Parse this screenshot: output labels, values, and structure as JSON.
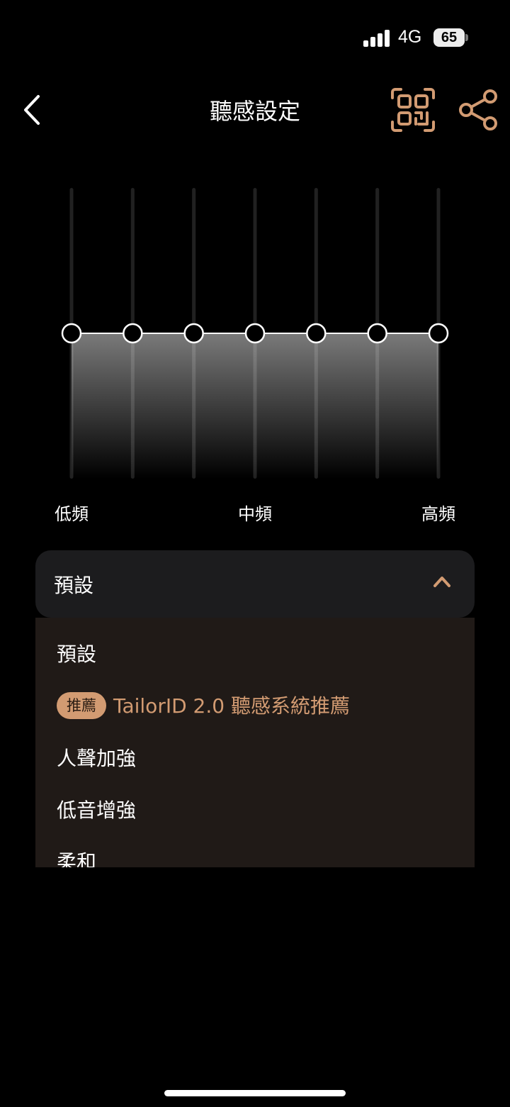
{
  "status_bar": {
    "network": "4G",
    "battery": "65"
  },
  "header": {
    "title": "聽感設定",
    "back_icon": "chevron-left-icon",
    "qr_icon": "qr-code-icon",
    "share_icon": "share-icon"
  },
  "equalizer": {
    "band_count": 7,
    "levels": [
      0,
      0,
      0,
      0,
      0,
      0,
      0
    ],
    "labels": {
      "low": "低頻",
      "mid": "中頻",
      "high": "高頻"
    }
  },
  "preset": {
    "selected": "預設",
    "expanded": true,
    "options": [
      {
        "label": "預設"
      },
      {
        "label": "TailorID 2.0 聽感系統推薦",
        "badge": "推薦"
      },
      {
        "label": "人聲加強"
      },
      {
        "label": "低音增強"
      },
      {
        "label": "柔和"
      }
    ]
  },
  "colors": {
    "background": "#000000",
    "accent": "#d29b72",
    "card": "#1c1c1e",
    "menu": "#201a17"
  }
}
